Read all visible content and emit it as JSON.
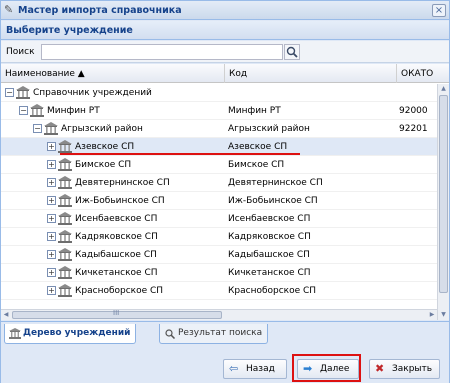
{
  "window": {
    "title": "Мастер импорта справочника",
    "close_glyph": "×"
  },
  "header": {
    "label": "Выберите учреждение"
  },
  "search": {
    "label": "Поиск",
    "value": "",
    "placeholder": ""
  },
  "grid": {
    "columns": [
      "Наименование ▲",
      "Код",
      "ОКАТО"
    ],
    "rows": [
      {
        "expander": "−",
        "name": "Справочник учреждений",
        "code": "",
        "okato": ""
      },
      {
        "expander": "−",
        "name": "Минфин РТ",
        "code": "Минфин РТ",
        "okato": "92000"
      },
      {
        "expander": "−",
        "name": "Агрызский район",
        "code": "Агрызский район",
        "okato": "92201"
      },
      {
        "expander": "+",
        "name": "Азевское СП",
        "code": "Азевское СП",
        "okato": "",
        "selected": true
      },
      {
        "expander": "+",
        "name": "Бимское СП",
        "code": "Бимское СП",
        "okato": ""
      },
      {
        "expander": "+",
        "name": "Девятернинское СП",
        "code": "Девятернинское СП",
        "okato": ""
      },
      {
        "expander": "+",
        "name": "Иж-Бобьинское СП",
        "code": "Иж-Бобьинское СП",
        "okato": ""
      },
      {
        "expander": "+",
        "name": "Исенбаевское СП",
        "code": "Исенбаевское СП",
        "okato": ""
      },
      {
        "expander": "+",
        "name": "Кадряковское СП",
        "code": "Кадряковское СП",
        "okato": ""
      },
      {
        "expander": "+",
        "name": "Кадыбашское СП",
        "code": "Кадыбашское СП",
        "okato": ""
      },
      {
        "expander": "+",
        "name": "Кичкетанское СП",
        "code": "Кичкетанское СП",
        "okato": ""
      },
      {
        "expander": "+",
        "name": "Красноборское СП",
        "code": "Красноборское СП",
        "okato": ""
      }
    ],
    "hscroll_grip": "III"
  },
  "tabs": [
    {
      "label": "Дерево учреждений",
      "active": true,
      "icon": "tree-icon"
    },
    {
      "label": "Результат поиска",
      "active": false,
      "icon": "search-icon"
    }
  ],
  "buttons": {
    "back": "Назад",
    "next": "Далее",
    "close": "Закрыть"
  },
  "colors": {
    "accent": "#15428b",
    "highlight": "#dd1111",
    "selected_row": "#dfe8f6"
  }
}
